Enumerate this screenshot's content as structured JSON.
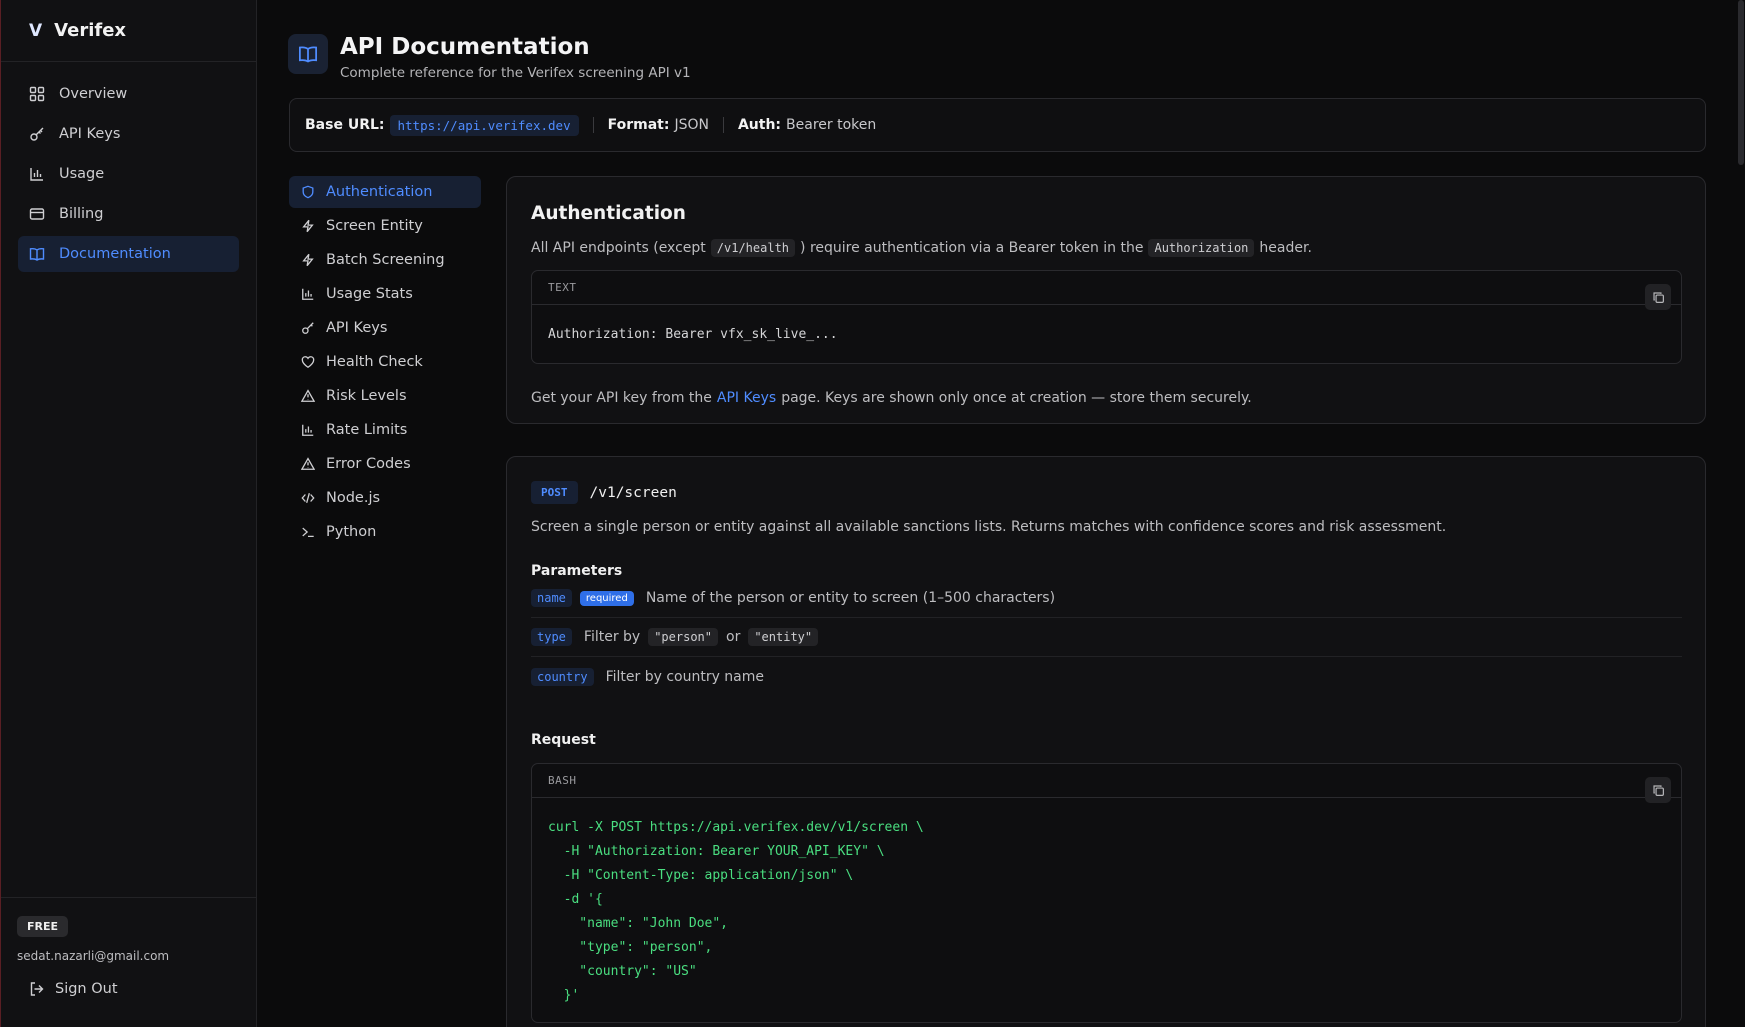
{
  "app": {
    "logo": "V",
    "name": "Verifex"
  },
  "sidebar": {
    "items": [
      {
        "label": "Overview",
        "icon": "grid-icon",
        "active": false
      },
      {
        "label": "API Keys",
        "icon": "key-icon",
        "active": false
      },
      {
        "label": "Usage",
        "icon": "bar-chart-icon",
        "active": false
      },
      {
        "label": "Billing",
        "icon": "credit-card-icon",
        "active": false
      },
      {
        "label": "Documentation",
        "icon": "book-icon",
        "active": true
      }
    ],
    "plan": "FREE",
    "email": "sedat.nazarli@gmail.com",
    "sign_out": "Sign Out"
  },
  "header": {
    "title": "API Documentation",
    "subtitle": "Complete reference for the Verifex screening API v1"
  },
  "info_bar": {
    "base_url_label": "Base URL:",
    "base_url": "https://api.verifex.dev",
    "format_label": "Format:",
    "format": "JSON",
    "auth_label": "Auth:",
    "auth": "Bearer token"
  },
  "doc_nav": {
    "items": [
      {
        "label": "Authentication",
        "icon": "shield-icon",
        "active": true
      },
      {
        "label": "Screen Entity",
        "icon": "zap-icon",
        "active": false
      },
      {
        "label": "Batch Screening",
        "icon": "zap-icon",
        "active": false
      },
      {
        "label": "Usage Stats",
        "icon": "bar-chart-icon",
        "active": false
      },
      {
        "label": "API Keys",
        "icon": "key-icon",
        "active": false
      },
      {
        "label": "Health Check",
        "icon": "heart-icon",
        "active": false
      },
      {
        "label": "Risk Levels",
        "icon": "warning-icon",
        "active": false
      },
      {
        "label": "Rate Limits",
        "icon": "bar-chart-icon",
        "active": false
      },
      {
        "label": "Error Codes",
        "icon": "warning-icon",
        "active": false
      },
      {
        "label": "Node.js",
        "icon": "code-icon",
        "active": false
      },
      {
        "label": "Python",
        "icon": "terminal-icon",
        "active": false
      }
    ]
  },
  "auth_section": {
    "title": "Authentication",
    "intro_1": "All API endpoints (except",
    "health_path": "/v1/health",
    "intro_2": ") require authentication via a Bearer token in the",
    "header_name": "Authorization",
    "intro_3": "header.",
    "code_lang": "TEXT",
    "code": "Authorization: Bearer vfx_sk_live_...",
    "note_1": "Get your API key from the",
    "note_link": "API Keys",
    "note_2": "page. Keys are shown only once at creation — store them securely."
  },
  "screen_section": {
    "method": "POST",
    "path": "/v1/screen",
    "description": "Screen a single person or entity against all available sanctions lists. Returns matches with confidence scores and risk assessment.",
    "params_label": "Parameters",
    "params": [
      {
        "name": "name",
        "required_label": "required",
        "desc": "Name of the person or entity to screen (1–500 characters)"
      },
      {
        "name": "type",
        "desc_1": "Filter by",
        "opt_1": "\"person\"",
        "desc_2": "or",
        "opt_2": "\"entity\""
      },
      {
        "name": "country",
        "desc": "Filter by country name"
      }
    ],
    "request_label": "Request",
    "code_lang": "BASH",
    "code_lines": [
      "curl -X POST https://api.verifex.dev/v1/screen \\",
      "  -H \"Authorization: Bearer YOUR_API_KEY\" \\",
      "  -H \"Content-Type: application/json\" \\",
      "  -d '{",
      "    \"name\": \"John Doe\",",
      "    \"type\": \"person\",",
      "    \"country\": \"US\"",
      "  }'"
    ]
  },
  "colors": {
    "accent": "#4f8cff",
    "code_green": "#4ade80",
    "background": "#0b0b0c"
  }
}
